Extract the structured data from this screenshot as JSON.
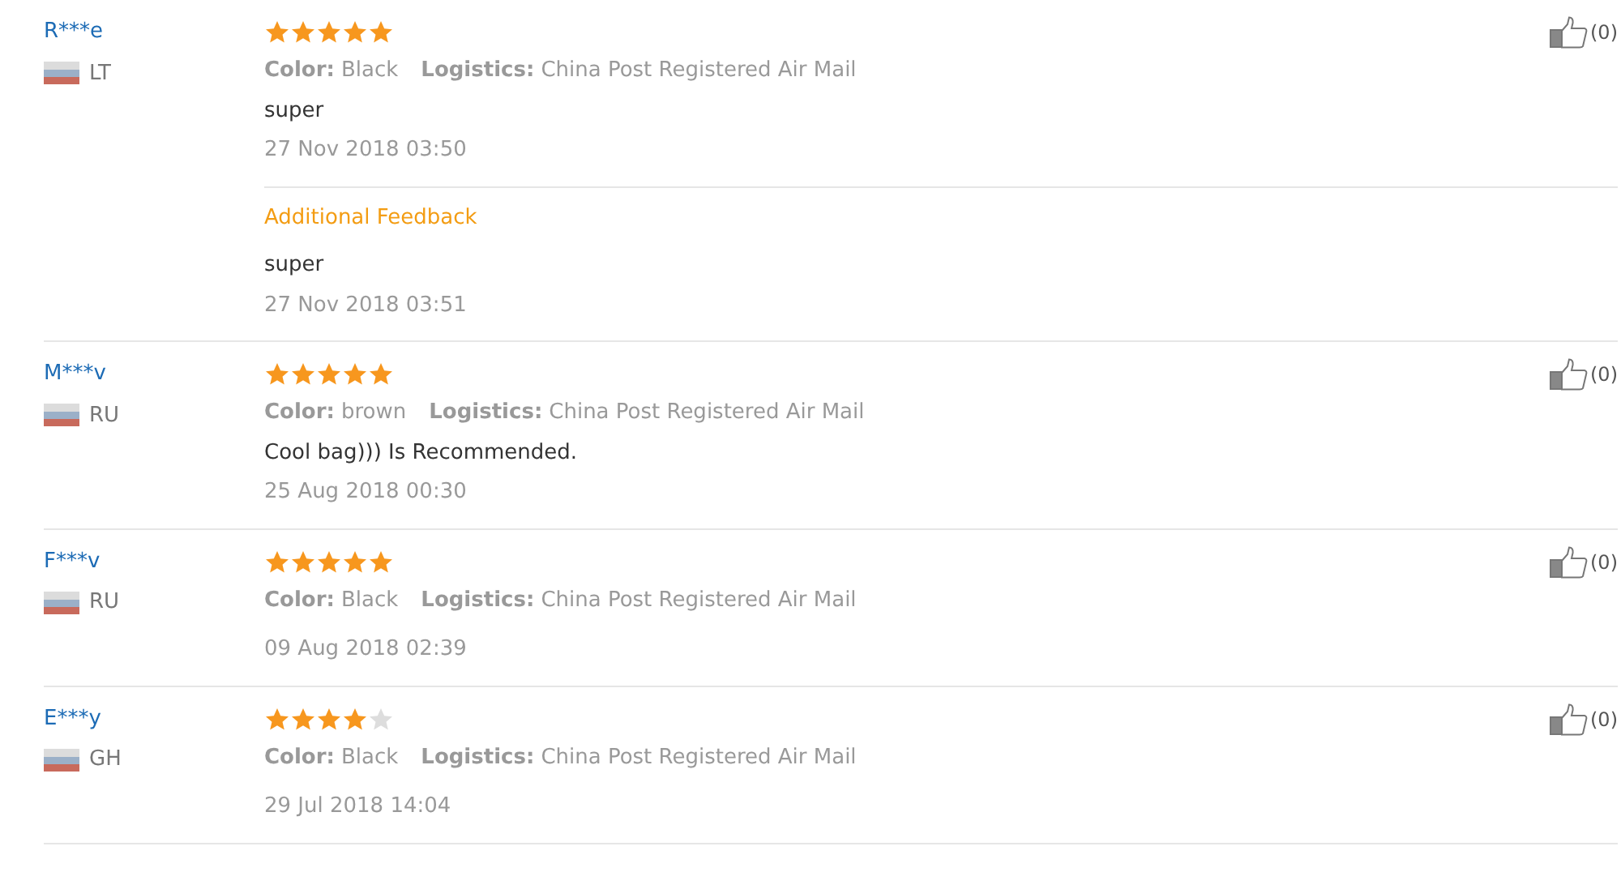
{
  "reviews": [
    {
      "user": "R***e",
      "country": "LT",
      "stars": 5,
      "color_label": "Color:",
      "product_color": "Black",
      "logistics_label": "Logistics:",
      "logistics": "China Post Registered Air Mail",
      "text": "super",
      "date": "27 Nov 2018 03:50",
      "likes": "(0)",
      "additional": {
        "label": "Additional Feedback",
        "text": "super",
        "date": "27 Nov 2018 03:51"
      }
    },
    {
      "user": "M***v",
      "country": "RU",
      "stars": 5,
      "color_label": "Color:",
      "product_color": "brown",
      "logistics_label": "Logistics:",
      "logistics": "China Post Registered Air Mail",
      "text": "Cool bag))) Is Recommended.",
      "date": "25 Aug 2018 00:30",
      "likes": "(0)"
    },
    {
      "user": "F***v",
      "country": "RU",
      "stars": 5,
      "color_label": "Color:",
      "product_color": "Black",
      "logistics_label": "Logistics:",
      "logistics": "China Post Registered Air Mail",
      "date": "09 Aug 2018 02:39",
      "likes": "(0)"
    },
    {
      "user": "E***y",
      "country": "GH",
      "stars": 4,
      "color_label": "Color:",
      "product_color": "Black",
      "logistics_label": "Logistics:",
      "logistics": "China Post Registered Air Mail",
      "date": "29 Jul 2018 14:04",
      "likes": "(0)"
    }
  ]
}
